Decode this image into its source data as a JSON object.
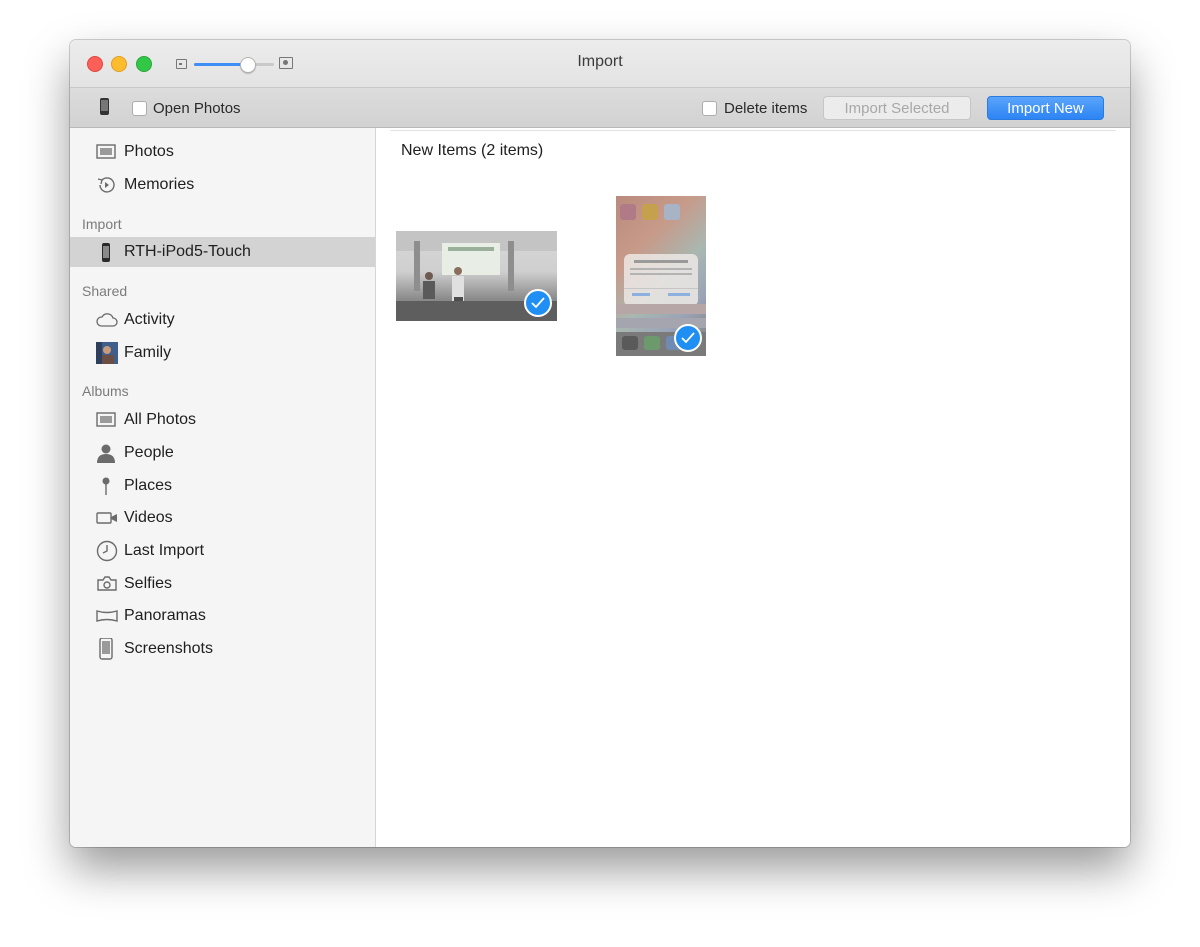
{
  "window": {
    "title": "Import"
  },
  "toolbar": {
    "open_photos_label": "Open Photos",
    "delete_items_label": "Delete items",
    "import_selected_label": "Import Selected",
    "import_new_label": "Import New",
    "zoom_level": 0.67
  },
  "sidebar": {
    "library": [
      {
        "label": "Photos",
        "icon": "photos-icon"
      },
      {
        "label": "Memories",
        "icon": "memories-icon"
      }
    ],
    "import_header": "Import",
    "import_items": [
      {
        "label": "RTH-iPod5-Touch",
        "icon": "ipod-icon",
        "selected": true
      }
    ],
    "shared_header": "Shared",
    "shared_items": [
      {
        "label": "Activity",
        "icon": "cloud-icon"
      },
      {
        "label": "Family",
        "icon": "family-avatar-icon"
      }
    ],
    "albums_header": "Albums",
    "album_items": [
      {
        "label": "All Photos",
        "icon": "all-photos-icon"
      },
      {
        "label": "People",
        "icon": "person-icon"
      },
      {
        "label": "Places",
        "icon": "pin-icon"
      },
      {
        "label": "Videos",
        "icon": "video-camera-icon"
      },
      {
        "label": "Last Import",
        "icon": "clock-icon"
      },
      {
        "label": "Selfies",
        "icon": "selfie-camera-icon"
      },
      {
        "label": "Panoramas",
        "icon": "panorama-icon"
      },
      {
        "label": "Screenshots",
        "icon": "phone-icon"
      }
    ]
  },
  "content": {
    "section_title": "New Items (2 items)"
  },
  "colors": {
    "accent": "#2d84f4",
    "check_badge": "#1f8ff4",
    "sidebar_bg": "#f5f5f5",
    "selected_bg": "#d3d3d3"
  }
}
